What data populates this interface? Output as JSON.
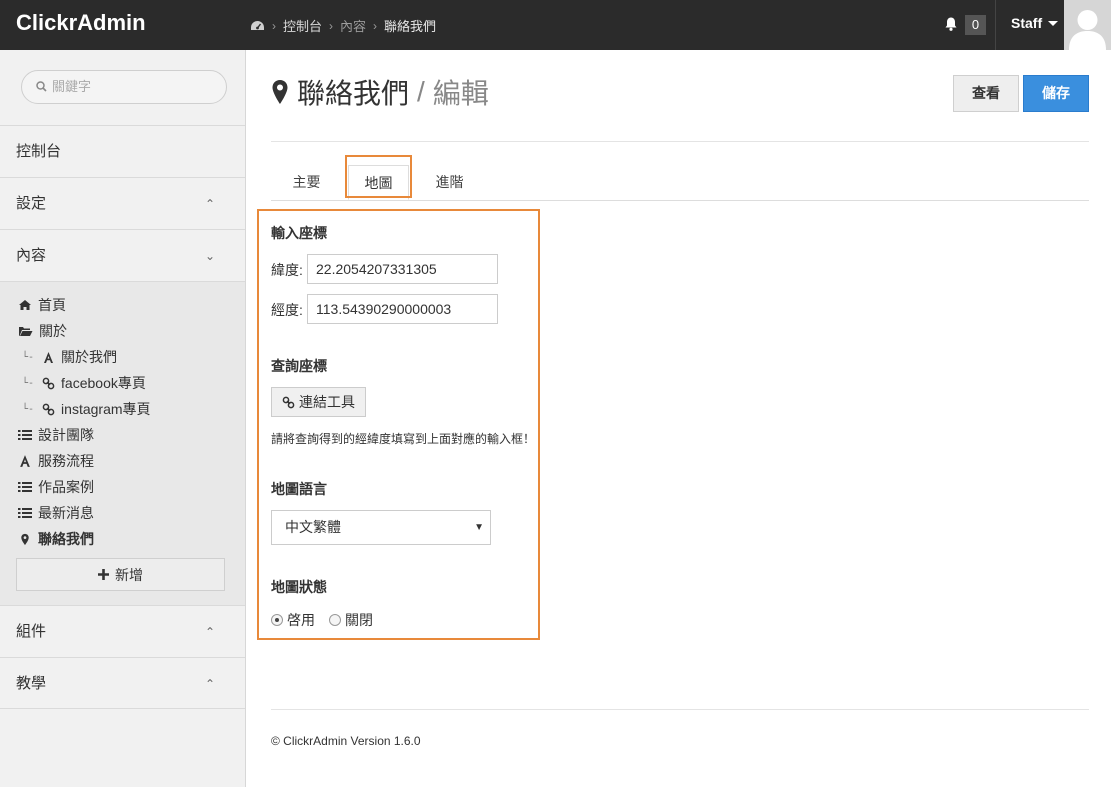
{
  "app": {
    "brand": "ClickrAdmin"
  },
  "breadcrumb": {
    "icon": "dashboard-icon",
    "items": [
      "控制台",
      "內容",
      "聯絡我們"
    ]
  },
  "topbar": {
    "notification_count": "0",
    "user_label": "Staff"
  },
  "sidebar": {
    "search_placeholder": "關鍵字",
    "nav": {
      "dashboard": "控制台",
      "settings": "設定",
      "content": "內容",
      "components": "組件",
      "tutorial": "教學"
    },
    "content_items": [
      {
        "label": "首頁",
        "icon": "home-icon"
      },
      {
        "label": "關於",
        "icon": "folder-open-icon"
      },
      {
        "label": "關於我們",
        "icon": "font-icon"
      },
      {
        "label": "facebook專頁",
        "icon": "link-icon"
      },
      {
        "label": "instagram專頁",
        "icon": "link-icon"
      },
      {
        "label": "設計團隊",
        "icon": "list-icon"
      },
      {
        "label": "服務流程",
        "icon": "font-icon"
      },
      {
        "label": "作品案例",
        "icon": "list-icon"
      },
      {
        "label": "最新消息",
        "icon": "list-icon"
      },
      {
        "label": "聯絡我們",
        "icon": "map-marker-icon"
      }
    ],
    "add_label": "新增"
  },
  "page": {
    "title": "聯絡我們",
    "separator": "/",
    "subtitle": "編輯",
    "view_label": "查看",
    "save_label": "儲存"
  },
  "tabs": [
    "主要",
    "地圖",
    "進階"
  ],
  "active_tab": "地圖",
  "map_form": {
    "coords_heading": "輸入座標",
    "lat_label": "緯度:",
    "lat_value": "22.2054207331305",
    "lng_label": "經度:",
    "lng_value": "113.54390290000003",
    "lookup_heading": "查詢座標",
    "link_tool_label": "連結工具",
    "hint": "請將查詢得到的經緯度填寫到上面對應的輸入框！",
    "lang_heading": "地圖語言",
    "lang_selected": "中文繁體",
    "status_heading": "地圖狀態",
    "status_on": "啓用",
    "status_off": "關閉",
    "status_selected": "啓用"
  },
  "footer": {
    "text": "© ClickrAdmin Version 1.6.0"
  },
  "colors": {
    "topbar": "#2b2b2b",
    "primary": "#3a8fde",
    "highlight": "#e8893a",
    "sidebar": "#f1f1f1"
  }
}
